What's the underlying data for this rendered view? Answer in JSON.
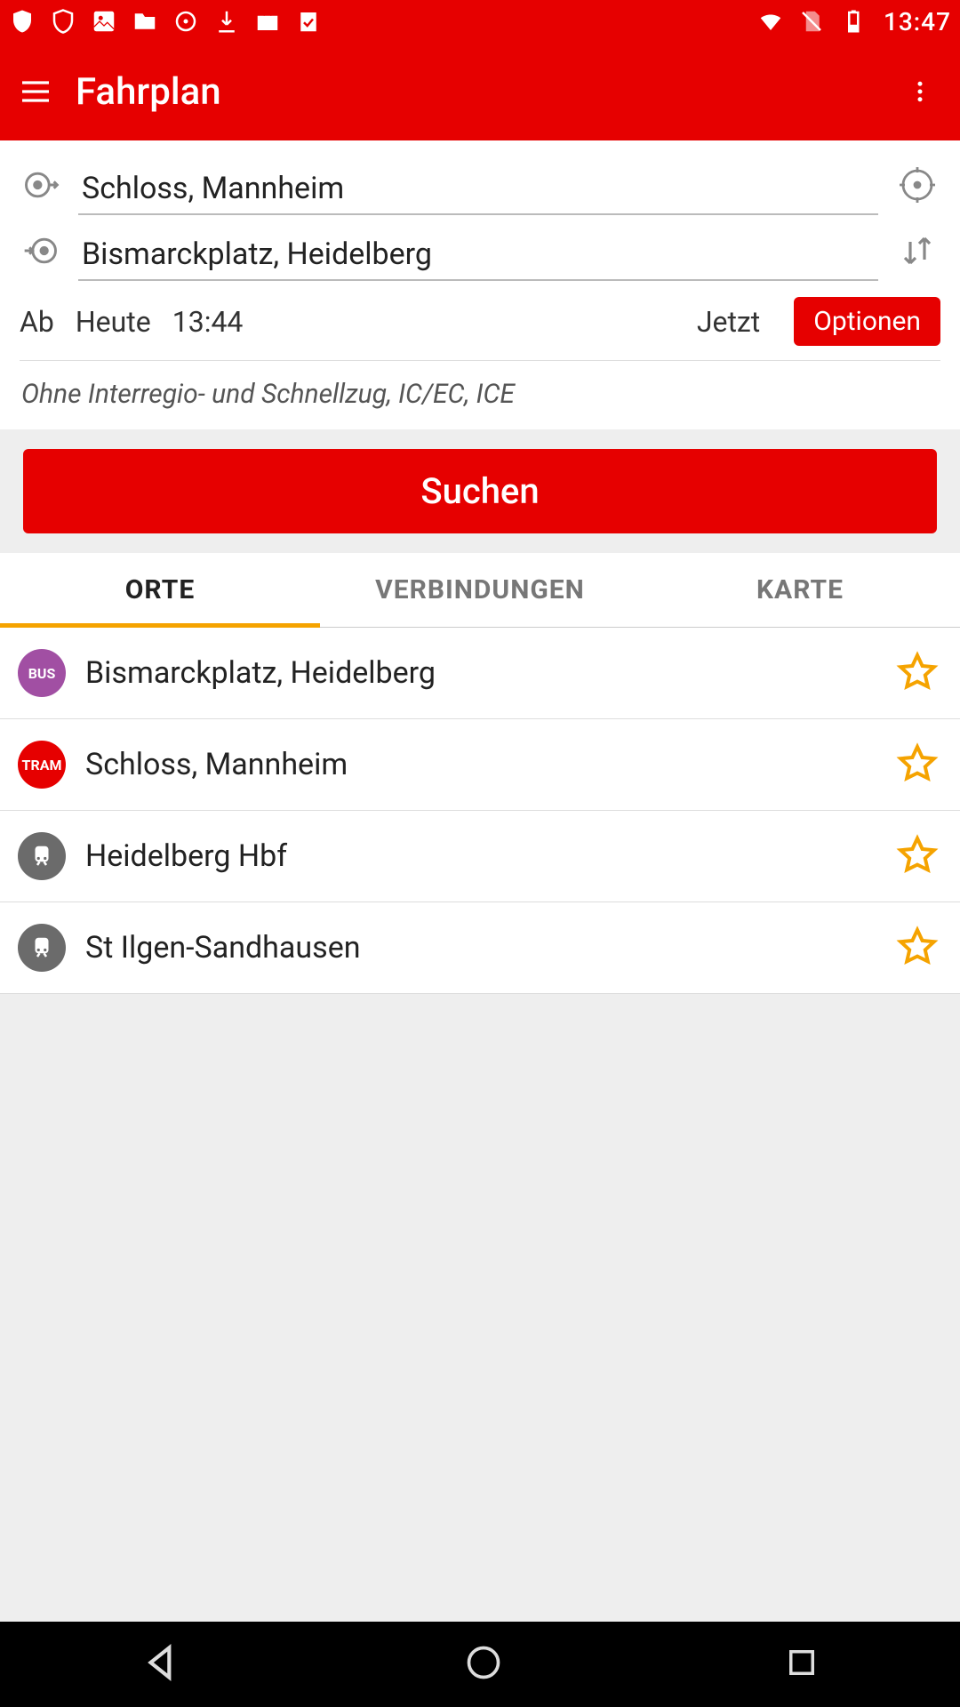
{
  "status": {
    "clock": "13:47"
  },
  "appbar": {
    "title": "Fahrplan"
  },
  "origin": {
    "value": "Schloss, Mannheim"
  },
  "destination": {
    "value": "Bismarckplatz, Heidelberg"
  },
  "timeRow": {
    "ab": "Ab",
    "heute": "Heute",
    "time": "13:44",
    "jetzt": "Jetzt",
    "optionen": "Optionen"
  },
  "filterNote": "Ohne Interregio- und Schnellzug, IC/EC, ICE",
  "searchBtn": "Suchen",
  "tabs": {
    "orte": "ORTE",
    "verbindungen": "VERBINDUNGEN",
    "karte": "KARTE"
  },
  "places": [
    {
      "badgeType": "bus",
      "badgeText": "BUS",
      "label": "Bismarckplatz, Heidelberg"
    },
    {
      "badgeType": "tram",
      "badgeText": "TRAM",
      "label": "Schloss, Mannheim"
    },
    {
      "badgeType": "train",
      "badgeText": "",
      "label": "Heidelberg Hbf"
    },
    {
      "badgeType": "train",
      "badgeText": "",
      "label": "St Ilgen-Sandhausen"
    }
  ]
}
